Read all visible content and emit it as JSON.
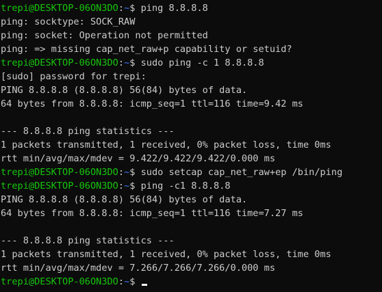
{
  "prompt": {
    "userhost": "trepi@DESKTOP-06ON3DO",
    "separator": ":",
    "path": "~",
    "symbol": "$ "
  },
  "lines": [
    {
      "type": "prompt",
      "command": "ping 8.8.8.8"
    },
    {
      "type": "output",
      "text": "ping: socktype: SOCK_RAW"
    },
    {
      "type": "output",
      "text": "ping: socket: Operation not permitted"
    },
    {
      "type": "output",
      "text": "ping: => missing cap_net_raw+p capability or setuid?"
    },
    {
      "type": "prompt",
      "command": "sudo ping -c 1 8.8.8.8"
    },
    {
      "type": "output",
      "text": "[sudo] password for trepi:"
    },
    {
      "type": "output",
      "text": "PING 8.8.8.8 (8.8.8.8) 56(84) bytes of data."
    },
    {
      "type": "output",
      "text": "64 bytes from 8.8.8.8: icmp_seq=1 ttl=116 time=9.42 ms"
    },
    {
      "type": "output",
      "text": ""
    },
    {
      "type": "output",
      "text": "--- 8.8.8.8 ping statistics ---"
    },
    {
      "type": "output",
      "text": "1 packets transmitted, 1 received, 0% packet loss, time 0ms"
    },
    {
      "type": "output",
      "text": "rtt min/avg/max/mdev = 9.422/9.422/9.422/0.000 ms"
    },
    {
      "type": "prompt",
      "command": "sudo setcap cap_net_raw+ep /bin/ping"
    },
    {
      "type": "prompt",
      "command": "ping -c1 8.8.8.8"
    },
    {
      "type": "output",
      "text": "PING 8.8.8.8 (8.8.8.8) 56(84) bytes of data."
    },
    {
      "type": "output",
      "text": "64 bytes from 8.8.8.8: icmp_seq=1 ttl=116 time=7.27 ms"
    },
    {
      "type": "output",
      "text": ""
    },
    {
      "type": "output",
      "text": "--- 8.8.8.8 ping statistics ---"
    },
    {
      "type": "output",
      "text": "1 packets transmitted, 1 received, 0% packet loss, time 0ms"
    },
    {
      "type": "output",
      "text": "rtt min/avg/max/mdev = 7.266/7.266/7.266/0.000 ms"
    },
    {
      "type": "prompt",
      "command": "",
      "cursor": true
    }
  ],
  "colors": {
    "background": "#0c0c0c",
    "text": "#cccccc",
    "userhost": "#16c60c",
    "path": "#3b78ff",
    "cursor": "#f2f2f2"
  }
}
